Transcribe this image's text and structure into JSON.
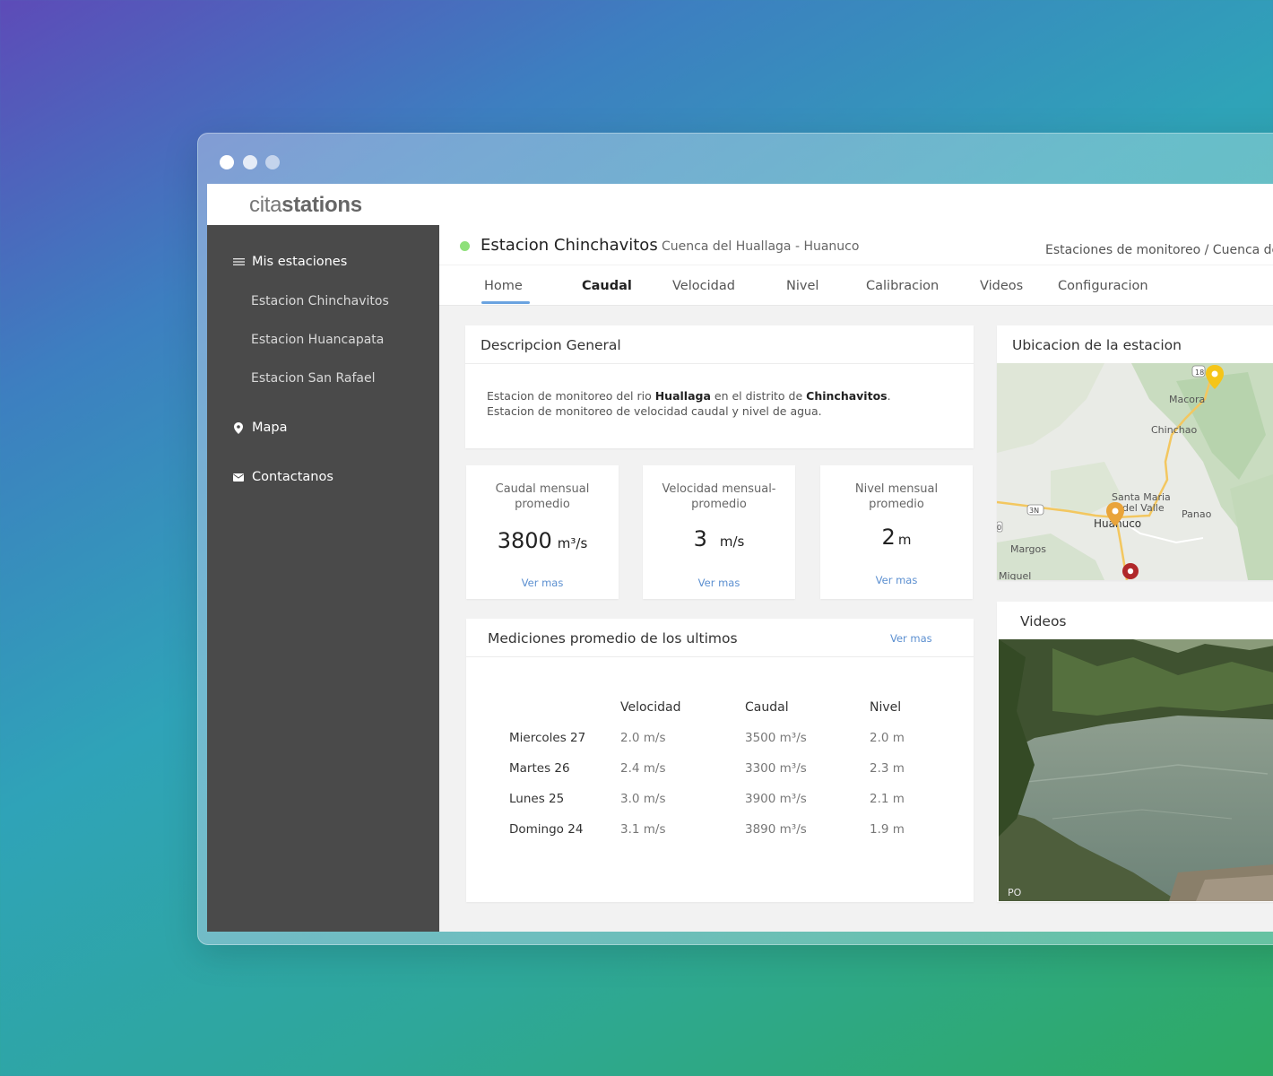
{
  "brand": {
    "light": "cita",
    "bold": "stations"
  },
  "sidebar": {
    "section_stations": "Mis estaciones",
    "stations": [
      "Estacion Chinchavitos",
      "Estacion Huancapata",
      "Estacion San Rafael"
    ],
    "map": "Mapa",
    "contact": "Contactanos"
  },
  "header": {
    "station_name": "Estacion Chinchavitos",
    "station_sub": "Cuenca del Huallaga - Huanuco",
    "breadcrumb": "Estaciones de monitoreo / Cuenca de",
    "status_color": "#8ee07a"
  },
  "tabs": [
    "Home",
    "Caudal",
    "Velocidad",
    "Nivel",
    "Calibracion",
    "Videos",
    "Configuracion"
  ],
  "description": {
    "title": "Descripcion General",
    "line1_a": "Estacion de monitoreo del rio ",
    "line1_river": "Huallaga",
    "line1_b": " en el distrito de ",
    "line1_district": "Chinchavitos",
    "line1_c": ".",
    "line2": "Estacion de monitoreo de velocidad caudal y nivel de agua."
  },
  "stats": [
    {
      "label1": "Caudal mensual",
      "label2": "promedio",
      "value": "3800",
      "unit": "m³/s",
      "link": "Ver mas"
    },
    {
      "label1": "Velocidad mensual-",
      "label2": "promedio",
      "value": "3",
      "unit": "m/s",
      "link": "Ver mas"
    },
    {
      "label1": "Nivel mensual",
      "label2": "promedio",
      "value": "2",
      "unit": "m",
      "link": "Ver mas"
    }
  ],
  "measurements": {
    "title": "Mediciones promedio de los ultimos",
    "link": "Ver mas",
    "headers": [
      "Velocidad",
      "Caudal",
      "Nivel"
    ],
    "rows": [
      {
        "day": "Miercoles 27",
        "velocidad": "2.0 m/s",
        "caudal": "3500 m³/s",
        "nivel": "2.0 m"
      },
      {
        "day": "Martes 26",
        "velocidad": "2.4 m/s",
        "caudal": "3300 m³/s",
        "nivel": "2.3 m"
      },
      {
        "day": "Lunes 25",
        "velocidad": "3.0 m/s",
        "caudal": "3900 m³/s",
        "nivel": "2.1 m"
      },
      {
        "day": "Domingo 24",
        "velocidad": "3.1 m/s",
        "caudal": "3890 m³/s",
        "nivel": "1.9 m"
      }
    ]
  },
  "location": {
    "title": "Ubicacion de la estacion",
    "places": [
      "Macora",
      "Chinchao",
      "Santa Maria",
      "del Valle",
      "Panao",
      "Huanuco",
      "Margos",
      "Miquel"
    ],
    "road_labels": [
      "18",
      "3N",
      "0"
    ]
  },
  "videos": {
    "title": "Videos",
    "watermark": "PO"
  }
}
